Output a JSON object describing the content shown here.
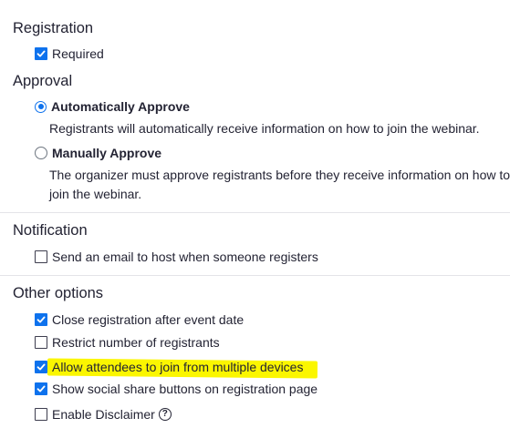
{
  "registration": {
    "title": "Registration",
    "required": {
      "label": "Required",
      "checked": true
    }
  },
  "approval": {
    "title": "Approval",
    "options": [
      {
        "label": "Automatically Approve",
        "selected": true,
        "description": [
          "Registrants will automatically receive information on how to join the webinar."
        ]
      },
      {
        "label": "Manually Approve",
        "selected": false,
        "description": [
          "The organizer must approve registrants before they receive information on how to",
          "join the webinar."
        ]
      }
    ]
  },
  "notification": {
    "title": "Notification",
    "email_host": {
      "label": "Send an email to host when someone registers",
      "checked": false
    }
  },
  "other_options": {
    "title": "Other options",
    "items": [
      {
        "label": "Close registration after event date",
        "checked": true
      },
      {
        "label": "Restrict number of registrants",
        "checked": false
      },
      {
        "label": "Allow attendees to join from multiple devices",
        "checked": true,
        "highlighted": true
      },
      {
        "label": "Show social share buttons on registration page",
        "checked": true
      },
      {
        "label": "Enable Disclaimer",
        "checked": false,
        "help_icon": "help-icon",
        "help_glyph": "?"
      }
    ]
  },
  "colors": {
    "accent": "#0e72ed",
    "highlight": "#fbf600",
    "text": "#232333",
    "divider": "#e4e4e8"
  }
}
